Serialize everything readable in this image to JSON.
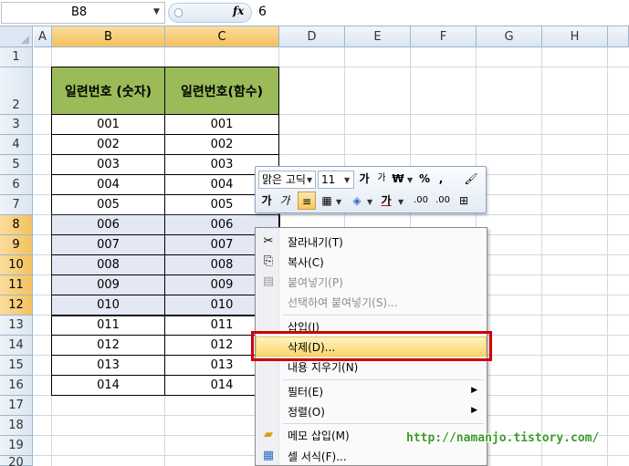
{
  "formula_bar": {
    "name_box": "B8",
    "fx_label": "fx",
    "value": "6"
  },
  "columns": [
    "A",
    "B",
    "C",
    "D",
    "E",
    "F",
    "G",
    "H"
  ],
  "rows": [
    "1",
    "2",
    "3",
    "4",
    "5",
    "6",
    "7",
    "8",
    "9",
    "10",
    "11",
    "12",
    "13",
    "14",
    "15",
    "16",
    "17",
    "18",
    "19",
    "20"
  ],
  "table": {
    "headers": [
      "일련번호 (숫자)",
      "일련번호(함수)"
    ],
    "rows": [
      [
        "001",
        "001"
      ],
      [
        "002",
        "002"
      ],
      [
        "003",
        "003"
      ],
      [
        "004",
        "004"
      ],
      [
        "005",
        "005"
      ],
      [
        "006",
        "006"
      ],
      [
        "007",
        "007"
      ],
      [
        "008",
        "008"
      ],
      [
        "009",
        "009"
      ],
      [
        "010",
        "010"
      ],
      [
        "011",
        "011"
      ],
      [
        "012",
        "012"
      ],
      [
        "013",
        "013"
      ],
      [
        "014",
        "014"
      ]
    ]
  },
  "mini_toolbar": {
    "font_name": "맑은 고딕",
    "font_size": "11",
    "grow_font": "가",
    "shrink_font": "가",
    "currency": "₩",
    "percent": "%",
    "comma": ",",
    "bold": "가",
    "italic": "가",
    "font_color": "가",
    "inc_decimal": ".00",
    "dec_decimal": ".00"
  },
  "context_menu": {
    "items": [
      {
        "label": "잘라내기(T)",
        "icon": "✂",
        "disabled": false
      },
      {
        "label": "복사(C)",
        "icon": "⎘",
        "disabled": false
      },
      {
        "label": "붙여넣기(P)",
        "icon": "📋",
        "disabled": true
      },
      {
        "label": "선택하여 붙여넣기(S)...",
        "icon": "",
        "disabled": true
      },
      {
        "label": "삽입(I)",
        "icon": "",
        "disabled": false
      },
      {
        "label": "삭제(D)...",
        "icon": "",
        "disabled": false
      },
      {
        "label": "내용 지우기(N)",
        "icon": "",
        "disabled": false
      },
      {
        "label": "필터(E)",
        "icon": "",
        "disabled": false
      },
      {
        "label": "정렬(O)",
        "icon": "",
        "disabled": false
      },
      {
        "label": "메모 삽입(M)",
        "icon": "",
        "disabled": false
      },
      {
        "label": "셀 서식(F)...",
        "icon": "",
        "disabled": false
      }
    ]
  },
  "watermark": "http://namanjo.tistory.com/"
}
